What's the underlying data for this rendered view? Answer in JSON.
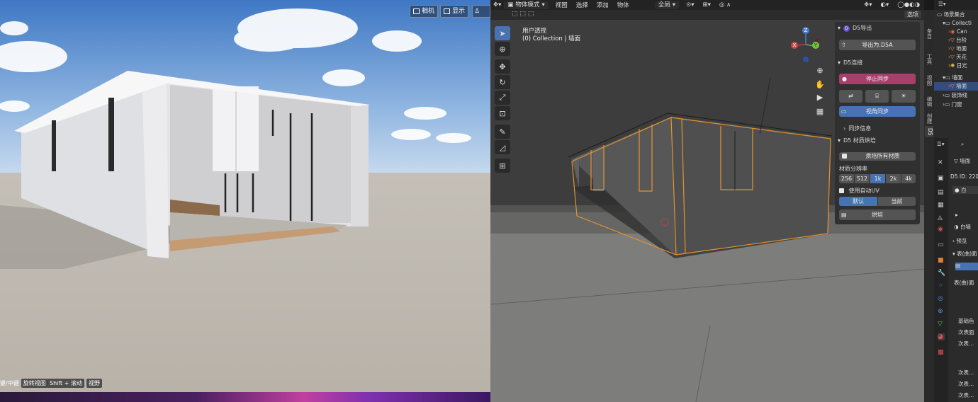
{
  "render": {
    "buttons": [
      {
        "label": "相机",
        "icon": "camera-icon"
      },
      {
        "label": "显示",
        "icon": "display-icon"
      },
      {
        "label": "",
        "icon": "person-icon"
      }
    ],
    "hints": [
      {
        "key": "键/中键",
        "action": "旋转视图"
      },
      {
        "key": "Shift + 滚动",
        "action": "视野"
      }
    ]
  },
  "viewport": {
    "header": {
      "mode": "物体模式",
      "menus": [
        "视图",
        "选择",
        "添加",
        "物体"
      ],
      "transform": "全局",
      "options": "选项"
    },
    "overlay_title": "用户透视",
    "overlay_subtitle": "(0) Collection | 墙面",
    "gizmo": {
      "x": "X",
      "y": "Y",
      "z": "Z"
    }
  },
  "d5_panel": {
    "export_section": "D5导出",
    "export_button": "导出为.D5A",
    "connect_section": "D5连接",
    "stop_sync": "停止同步",
    "view_sync": "视角同步",
    "sync_info": "同步信息",
    "bake_section": "D5 材质烘培",
    "bake_all": "烘培所有材质",
    "resolution_label": "材质分辨率",
    "resolutions": [
      "256",
      "512",
      "1k",
      "2k",
      "4k"
    ],
    "resolution_selected": "1k",
    "auto_uv": "使用自动UV",
    "default_label": "默认",
    "current_label": "当前",
    "bake_button": "烘培"
  },
  "side_tabs": [
    "条目",
    "工具",
    "视图",
    "编辑",
    "创建",
    "D5"
  ],
  "outliner": {
    "root": "场景集合",
    "items": [
      {
        "label": "Collecti",
        "level": 1,
        "icon": "collection-icon"
      },
      {
        "label": "Can",
        "level": 2,
        "icon": "camera-icon"
      },
      {
        "label": "台阶",
        "level": 2,
        "icon": "mesh-icon"
      },
      {
        "label": "地面",
        "level": 2,
        "icon": "mesh-icon"
      },
      {
        "label": "天花",
        "level": 2,
        "icon": "mesh-icon"
      },
      {
        "label": "日光",
        "level": 2,
        "icon": "light-icon"
      },
      {
        "label": "墙面",
        "level": 1,
        "icon": "collection-icon"
      },
      {
        "label": "墙面",
        "level": 2,
        "icon": "mesh-icon",
        "selected": true
      },
      {
        "label": "装饰线",
        "level": 1,
        "icon": "collection-icon"
      },
      {
        "label": "门窗",
        "level": 1,
        "icon": "collection-icon"
      }
    ]
  },
  "properties": {
    "object_name": "墙面",
    "d5_id": "D5 ID: 220",
    "material": "白",
    "material2": "白墙",
    "preview": "预览",
    "surface": "表(曲)面",
    "surface2": "表(曲)面",
    "base_color": "基础色",
    "sub1": "次表面",
    "sub2": "次表...",
    "sub3": "次表...",
    "sub4": "次表...",
    "sub5": "次表..."
  }
}
